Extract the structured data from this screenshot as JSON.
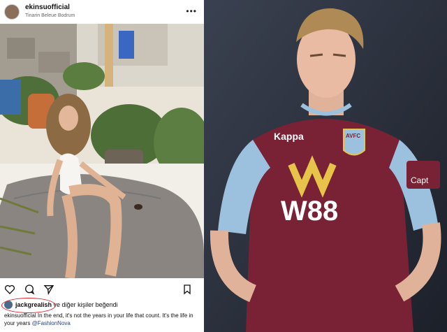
{
  "post": {
    "username": "ekinsuofficial",
    "location": "Tinarin Beleue Bodrum",
    "more_icon": "more-horizontal-icon",
    "liked_by_user": "jackgrealish",
    "liked_by_rest": "ve diğer kişiler beğendi",
    "caption_user": "ekinsuofficial",
    "caption_text": " In the end, it's not the years in your life that count. It's the life in your years ",
    "caption_mention": "@FashionNova"
  },
  "jersey": {
    "sponsor_word": "W88",
    "crest": "AVFC",
    "brand": "Kappa",
    "captain_band": "Capt"
  },
  "colors": {
    "highlight": "#d9232a",
    "claret": "#7a2235",
    "sky_blue": "#9cc1df"
  }
}
